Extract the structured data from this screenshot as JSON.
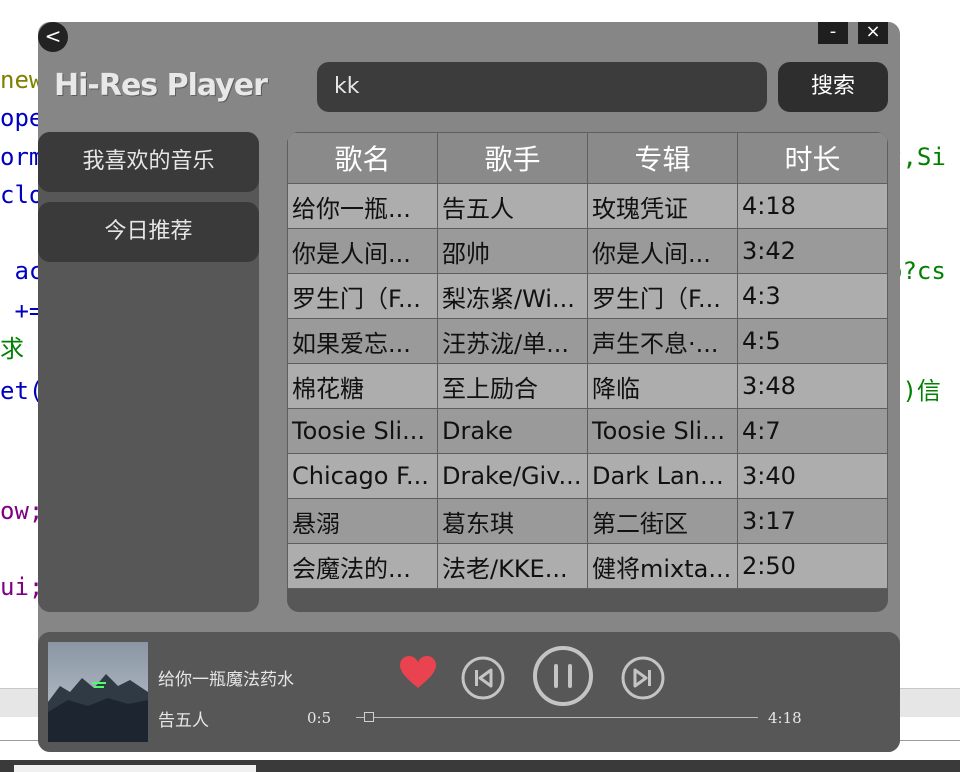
{
  "background_code": {
    "lines": [
      {
        "text": "new",
        "color": "#808000"
      },
      {
        "text": "oper",
        "color": "#0000c0"
      },
      {
        "text": "orm",
        "color": "#0000c0"
      },
      {
        "text": "clos",
        "color": "#0000c0"
      },
      {
        "text": " ac",
        "color": "#0000c0"
      },
      {
        "text": " +=",
        "color": "#0000c0"
      },
      {
        "text": "求",
        "color": "#008000"
      },
      {
        "text": "et(",
        "color": "#0000c0"
      },
      {
        "text": "ow;",
        "color": "#800080"
      },
      {
        "text": "ui;",
        "color": "#800080"
      }
    ],
    "right_lines": [
      {
        "text": "t,Si",
        "color": "#008000"
      },
      {
        "text": "o?cs",
        "color": "#008000"
      },
      {
        "text": "()信",
        "color": "#008000"
      }
    ]
  },
  "window": {
    "back_label": "<",
    "minimize_label": "-",
    "close_label": "×",
    "logo": "Hi-Res Player"
  },
  "search": {
    "value": "kk",
    "button_label": "搜索"
  },
  "sidebar": {
    "items": [
      {
        "label": "我喜欢的音乐"
      },
      {
        "label": "今日推荐"
      }
    ]
  },
  "table": {
    "headers": [
      "歌名",
      "歌手",
      "专辑",
      "时长"
    ],
    "rows": [
      [
        "给你一瓶...",
        "告五人",
        "玫瑰凭证",
        "4:18"
      ],
      [
        "你是人间...",
        "邵帅",
        "你是人间...",
        "3:42"
      ],
      [
        "罗生门（F...",
        "梨冻紧/Wi...",
        "罗生门（F...",
        "4:3"
      ],
      [
        "如果爱忘...",
        "汪苏泷/单...",
        "声生不息·...",
        "4:5"
      ],
      [
        "棉花糖",
        "至上励合",
        "降临",
        "3:48"
      ],
      [
        "Toosie Sli...",
        "Drake",
        "Toosie Sli...",
        "4:7"
      ],
      [
        "Chicago F...",
        "Drake/Giv...",
        "Dark Lane...",
        "3:40"
      ],
      [
        "悬溺",
        "葛东琪",
        "第二街区",
        "3:17"
      ],
      [
        "会魔法的...",
        "法老/KKE...",
        "健将mixta...",
        "2:50"
      ]
    ]
  },
  "player": {
    "title": "给你一瓶魔法药水",
    "artist": "告五人",
    "current_time": "0:5",
    "total_time": "4:18",
    "progress": 0.02,
    "liked": true,
    "icons": {
      "like": "heart-icon",
      "prev": "skip-previous-icon",
      "play_pause": "pause-icon",
      "next": "skip-next-icon"
    },
    "heart_color": "#e8434f"
  }
}
